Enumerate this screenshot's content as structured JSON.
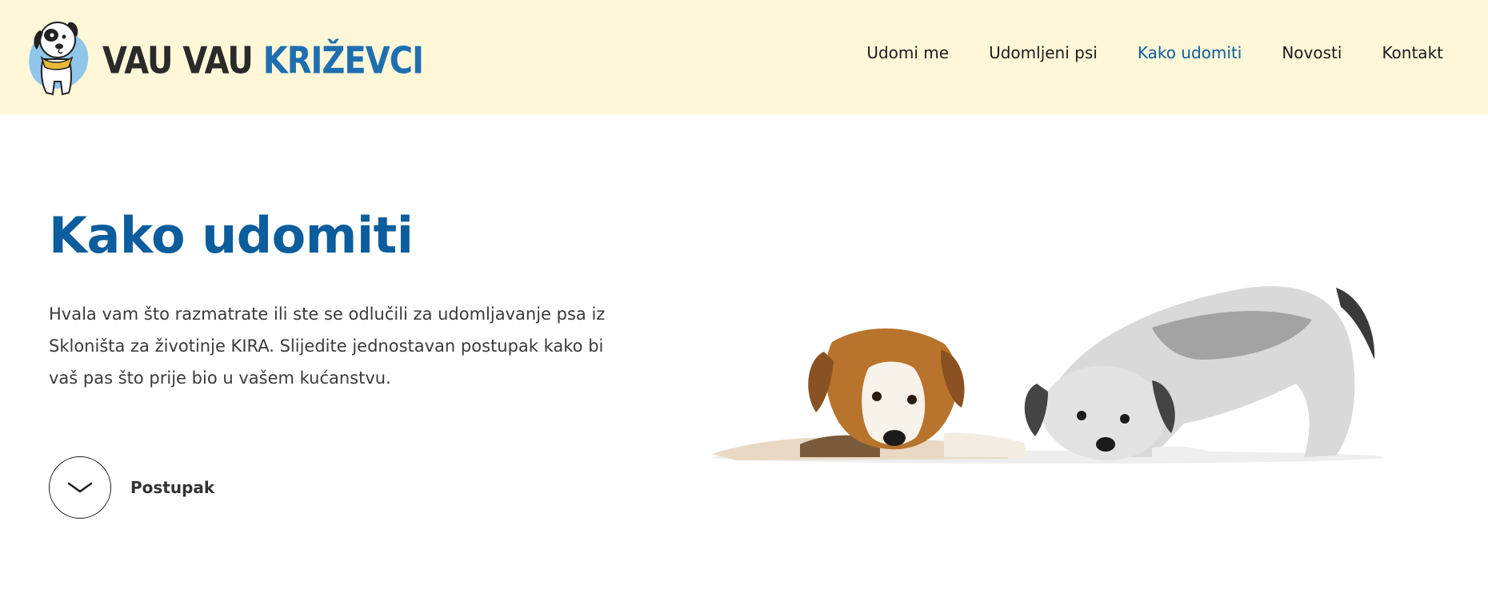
{
  "brand": {
    "logo_part1": "VAU VAU ",
    "logo_part2": "KRIŽEVCI"
  },
  "nav": {
    "items": [
      {
        "label": "Udomi me",
        "active": false
      },
      {
        "label": "Udomljeni psi",
        "active": false
      },
      {
        "label": "Kako udomiti",
        "active": true
      },
      {
        "label": "Novosti",
        "active": false
      },
      {
        "label": "Kontakt",
        "active": false
      }
    ]
  },
  "hero": {
    "title": "Kako udomiti",
    "description": "Hvala vam što razmatrate ili ste se odlučili za udomljavanje psa iz Skloništa za životinje KIRA. Slijedite jednostavan postupak kako bi vaš pas što prije bio u vašem kućanstvu.",
    "cta_label": "Postupak"
  },
  "colors": {
    "header_bg": "#fff7d8",
    "accent_blue": "#0c5d9d",
    "text_dark": "#1b1b1b"
  },
  "icons": {
    "cta": "chevron-down-icon",
    "logo": "dog-mascot-icon"
  }
}
